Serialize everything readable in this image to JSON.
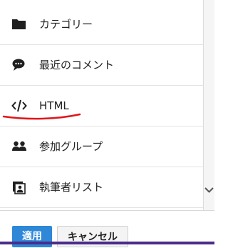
{
  "menu": {
    "items": [
      {
        "label": "カテゴリー",
        "icon": "folder-icon"
      },
      {
        "label": "最近のコメント",
        "icon": "comment-icon"
      },
      {
        "label": "HTML",
        "icon": "code-icon"
      },
      {
        "label": "参加グループ",
        "icon": "group-icon"
      },
      {
        "label": "執筆者リスト",
        "icon": "author-list-icon"
      }
    ]
  },
  "footer": {
    "apply_label": "適用",
    "cancel_label": "キャンセル"
  },
  "colors": {
    "apply_bg": "#2e87d7",
    "annotation_red": "#e0161b",
    "bottom_bar": "#4b2c8a"
  }
}
